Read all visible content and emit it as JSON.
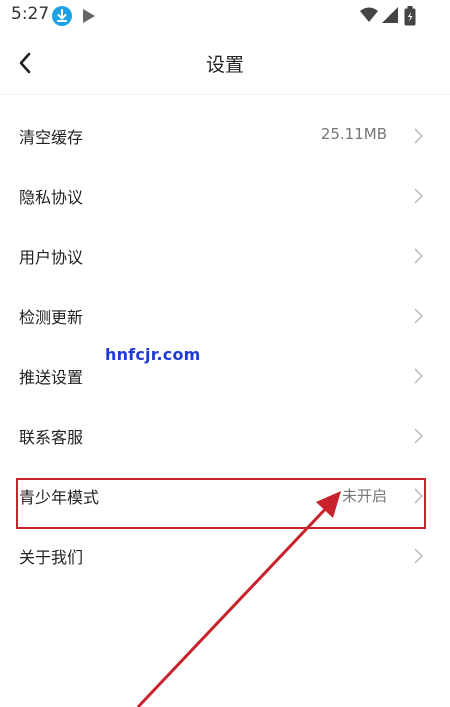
{
  "status_bar": {
    "time": "5:27",
    "icons": [
      "download-icon",
      "play-icon",
      "wifi-icon",
      "signal-icon",
      "battery-icon"
    ]
  },
  "header": {
    "back_icon": "chevron-left-icon",
    "title": "设置"
  },
  "settings": {
    "items": [
      {
        "label": "清空缓存",
        "value": "25.11MB"
      },
      {
        "label": "隐私协议",
        "value": ""
      },
      {
        "label": "用户协议",
        "value": ""
      },
      {
        "label": "检测更新",
        "value": ""
      },
      {
        "label": "推送设置",
        "value": ""
      },
      {
        "label": "联系客服",
        "value": ""
      },
      {
        "label": "青少年模式",
        "value": "未开启"
      },
      {
        "label": "关于我们",
        "value": ""
      }
    ]
  },
  "watermark": "hnfcjr.com",
  "colors": {
    "annotation_red": "#c8232c",
    "watermark_blue": "#1f3bd6",
    "download_badge": "#1aa3e8"
  }
}
